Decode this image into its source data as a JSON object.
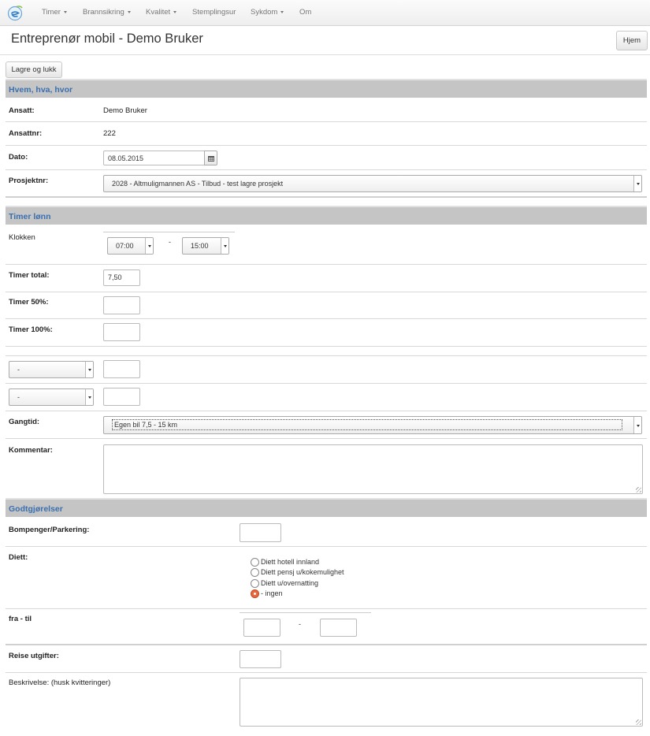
{
  "nav": {
    "items": [
      {
        "label": "Timer",
        "dropdown": true
      },
      {
        "label": "Brannsikring",
        "dropdown": true
      },
      {
        "label": "Kvalitet",
        "dropdown": true
      },
      {
        "label": "Stemplingsur",
        "dropdown": false
      },
      {
        "label": "Sykdom",
        "dropdown": true
      },
      {
        "label": "Om",
        "dropdown": false
      }
    ]
  },
  "header": {
    "title": "Entreprenør mobil - Demo Bruker",
    "home_button": "Hjem"
  },
  "toolbar": {
    "save_close": "Lagre og lukk"
  },
  "sections": {
    "who": "Hvem, hva, hvor",
    "hours": "Timer lønn",
    "allowances": "Godtgjørelser"
  },
  "fields": {
    "ansatt": {
      "label": "Ansatt:",
      "value": "Demo Bruker"
    },
    "ansattnr": {
      "label": "Ansattnr:",
      "value": "222"
    },
    "dato": {
      "label": "Dato:",
      "value": "08.05.2015"
    },
    "prosjekt": {
      "label": "Prosjektnr:",
      "value": "2028 - Altmuligmannen AS - Tilbud - test lagre prosjekt"
    },
    "klokken": {
      "label": "Klokken",
      "from": "07:00",
      "separator": "-",
      "to": "15:00"
    },
    "timer_total": {
      "label": "Timer total:",
      "value": "7,50"
    },
    "timer_50": {
      "label": "Timer 50%:",
      "value": ""
    },
    "timer_100": {
      "label": "Timer 100%:",
      "value": ""
    },
    "extra_1": {
      "select": "-",
      "value": ""
    },
    "extra_2": {
      "select": "-",
      "value": ""
    },
    "gangtid": {
      "label": "Gangtid:",
      "value": "Egen bil 7,5 - 15 km"
    },
    "kommentar": {
      "label": "Kommentar:",
      "value": ""
    },
    "bompenger": {
      "label": "Bompenger/Parkering:",
      "value": ""
    },
    "diett": {
      "label": "Diett:",
      "options": [
        "Diett hotell innland",
        "Diett pensj u/kokemulighet",
        "Diett u/overnatting",
        "- ingen"
      ],
      "selected": "- ingen"
    },
    "fra_til": {
      "label": "fra - til",
      "separator": "-"
    },
    "reise": {
      "label": "Reise utgifter:",
      "value": ""
    },
    "beskrivelse": {
      "label": "Beskrivelse: (husk kvitteringer)",
      "value": ""
    }
  },
  "colors": {
    "section_bg": "#c5c5c5",
    "section_text": "#3a6fb0",
    "radio_checked": "#e9673f"
  }
}
